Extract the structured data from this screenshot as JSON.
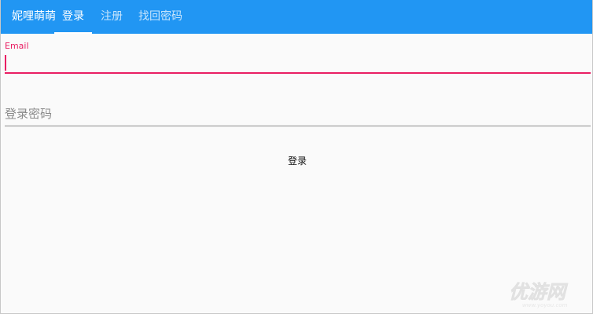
{
  "header": {
    "brand": "妮哩萌萌",
    "tabs": [
      {
        "label": "登录",
        "active": true
      },
      {
        "label": "注册",
        "active": false
      },
      {
        "label": "找回密码",
        "active": false
      }
    ]
  },
  "form": {
    "email": {
      "label": "Email",
      "value": ""
    },
    "password": {
      "placeholder": "登录密码",
      "value": ""
    },
    "submit_label": "登录"
  },
  "colors": {
    "appbar": "#2196f3",
    "accent": "#e91e63",
    "background": "#fafafa"
  },
  "watermark": {
    "text": "优游网",
    "subtext": "www.yoyou.com"
  }
}
